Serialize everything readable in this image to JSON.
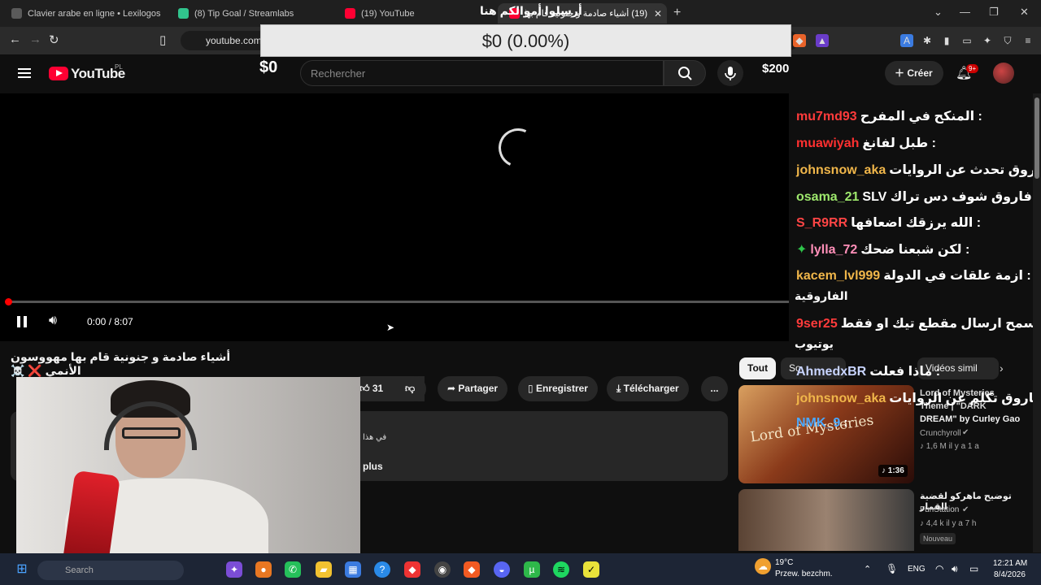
{
  "browser": {
    "tabs": [
      {
        "title": "Clavier arabe en ligne • Lexilogos",
        "color": "#5a5a5a"
      },
      {
        "title": "(8) Tip Goal / Streamlabs",
        "color": "#31c48d"
      },
      {
        "title": "(19) YouTube",
        "color": "#ff0033"
      },
      {
        "title": "(19) أشياء صادمة و جنونية قام بها",
        "color": "#ff0033"
      }
    ],
    "new_tab": "+",
    "url": "youtube.com",
    "overlay_title": "أرسلوا أموالكم هنا"
  },
  "goal": {
    "progress_text": "$0 (0.00%)",
    "progress_fraction": 0,
    "start": "$0",
    "target": "$200"
  },
  "youtube": {
    "brand": "YouTube",
    "country": "PL",
    "search_placeholder": "Rechercher",
    "create_label": "Créer",
    "notif_count": "9+"
  },
  "player": {
    "time": "0:00 / 8:07",
    "progress_fraction": 0
  },
  "video": {
    "title": "أشياء صادمة و جنونية قام بها مهووسون الأنمي ❌ ☠️",
    "likes": "31",
    "share": "Partager",
    "save": "Enregistrer",
    "download": "Télécharger",
    "more": "...",
    "desc_snippet": "في هذا",
    "desc_more": "plus"
  },
  "chips": {
    "all": "Tout",
    "s2": "So",
    "similar": "Vidéos simil"
  },
  "recommended": [
    {
      "title_a": "Lord of Mysteries",
      "title_b": "Theme | \"DARK",
      "title_c": "DREAM\" by Curley Gao",
      "channel": "Crunchyroll",
      "meta": "1,6 M   il y a 1 a",
      "duration": "1:36",
      "thumb_text": "Lord of Mysteries"
    },
    {
      "title": "توضيح ماهركو لقضية القمار",
      "channel": "FunStation",
      "meta": "4,4 k   il y a 7 h",
      "badge": "Nouveau"
    }
  ],
  "chat": [
    {
      "user": "mu7md93",
      "color": "#ff3b3b",
      "msg": ": المنكح في المفرح"
    },
    {
      "user": "muawiyah",
      "color": "#ff3030",
      "msg": ": طبل لفانغ"
    },
    {
      "user": "johnsnow_aka",
      "color": "#f0b64a",
      "msg": ": فاروق تحدث عن الروايات"
    },
    {
      "user": "osama_21",
      "color": "#9ee86d",
      "msg": ": فاروق شوف دس تراك SLV"
    },
    {
      "user": "S_R9RR",
      "color": "#ff4545",
      "msg": ": الله يرزقك اضعافها"
    },
    {
      "user": "lylla_72",
      "color": "#ff8fb8",
      "msg": ": لكن شبعنا ضحك"
    },
    {
      "user": "kacem_lvl999",
      "color": "#f0b64a",
      "msg": ": ازمة علقات في الدولة",
      "cont": "الفاروقية"
    },
    {
      "user": "9ser25",
      "color": "#ff3b3b",
      "msg": ": هل تسمح ارسال مقطع تيك او فقط",
      "cont": "يوتيوب"
    },
    {
      "user": "AhmedxBR",
      "color": "#c8d4ff",
      "msg": ": ماذا فعلت"
    },
    {
      "user": "johnsnow_aka",
      "color": "#f0b64a",
      "msg": ": فاروق تكلم عن الروايات"
    },
    {
      "user": "NMK_9",
      "color": "#4aa8ff",
      "msg": ":"
    }
  ],
  "taskbar": {
    "search": "Search",
    "weather_temp": "19°C",
    "weather_desc": "Przew. bezchm.",
    "lang": "ENG",
    "time": "12:21 AM",
    "date": "8/4/2026"
  }
}
